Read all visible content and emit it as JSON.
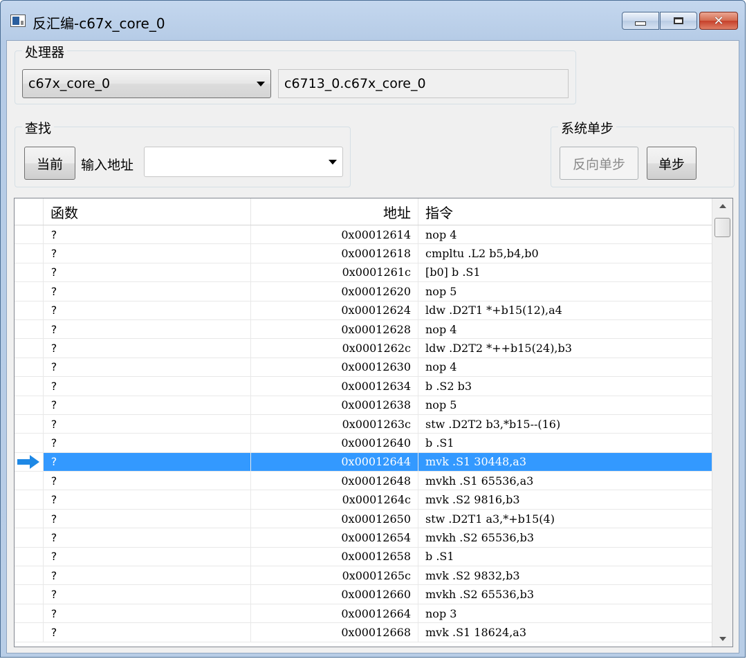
{
  "window": {
    "title": "反汇编-c67x_core_0"
  },
  "processor": {
    "group_title": "处理器",
    "selected": "c67x_core_0",
    "full_name": "c6713_0.c67x_core_0"
  },
  "find": {
    "group_title": "查找",
    "current_button": "当前",
    "address_label": "输入地址",
    "address_value": ""
  },
  "step": {
    "group_title": "系统单步",
    "reverse_button": "反向单步",
    "step_button": "单步"
  },
  "table": {
    "headers": {
      "function": "函数",
      "address": "地址",
      "instruction": "指令"
    },
    "selected_index": 12,
    "rows": [
      {
        "func": "?",
        "addr": "0x00012614",
        "inst": "nop 4"
      },
      {
        "func": "?",
        "addr": "0x00012618",
        "inst": "cmpltu .L2 b5,b4,b0"
      },
      {
        "func": "?",
        "addr": "0x0001261c",
        "inst": "[b0] b .S1"
      },
      {
        "func": "?",
        "addr": "0x00012620",
        "inst": "nop 5"
      },
      {
        "func": "?",
        "addr": "0x00012624",
        "inst": "ldw .D2T1 *+b15(12),a4"
      },
      {
        "func": "?",
        "addr": "0x00012628",
        "inst": "nop 4"
      },
      {
        "func": "?",
        "addr": "0x0001262c",
        "inst": "ldw .D2T2 *++b15(24),b3"
      },
      {
        "func": "?",
        "addr": "0x00012630",
        "inst": "nop 4"
      },
      {
        "func": "?",
        "addr": "0x00012634",
        "inst": "b .S2 b3"
      },
      {
        "func": "?",
        "addr": "0x00012638",
        "inst": "nop 5"
      },
      {
        "func": "?",
        "addr": "0x0001263c",
        "inst": "stw .D2T2 b3,*b15--(16)"
      },
      {
        "func": "?",
        "addr": "0x00012640",
        "inst": "b .S1"
      },
      {
        "func": "?",
        "addr": "0x00012644",
        "inst": "mvk .S1 30448,a3"
      },
      {
        "func": "?",
        "addr": "0x00012648",
        "inst": "mvkh .S1 65536,a3"
      },
      {
        "func": "?",
        "addr": "0x0001264c",
        "inst": "mvk .S2 9816,b3"
      },
      {
        "func": "?",
        "addr": "0x00012650",
        "inst": "stw .D2T1 a3,*+b15(4)"
      },
      {
        "func": "?",
        "addr": "0x00012654",
        "inst": "mvkh .S2 65536,b3"
      },
      {
        "func": "?",
        "addr": "0x00012658",
        "inst": "b .S1"
      },
      {
        "func": "?",
        "addr": "0x0001265c",
        "inst": "mvk .S2 9832,b3"
      },
      {
        "func": "?",
        "addr": "0x00012660",
        "inst": "mvkh .S2 65536,b3"
      },
      {
        "func": "?",
        "addr": "0x00012664",
        "inst": "nop 3"
      },
      {
        "func": "?",
        "addr": "0x00012668",
        "inst": "mvk .S1 18624,a3"
      }
    ]
  },
  "colors": {
    "selection": "#3399ff",
    "pc_arrow": "#1e88e5"
  },
  "icons": {
    "pc_marker": "arrow-right-icon"
  }
}
